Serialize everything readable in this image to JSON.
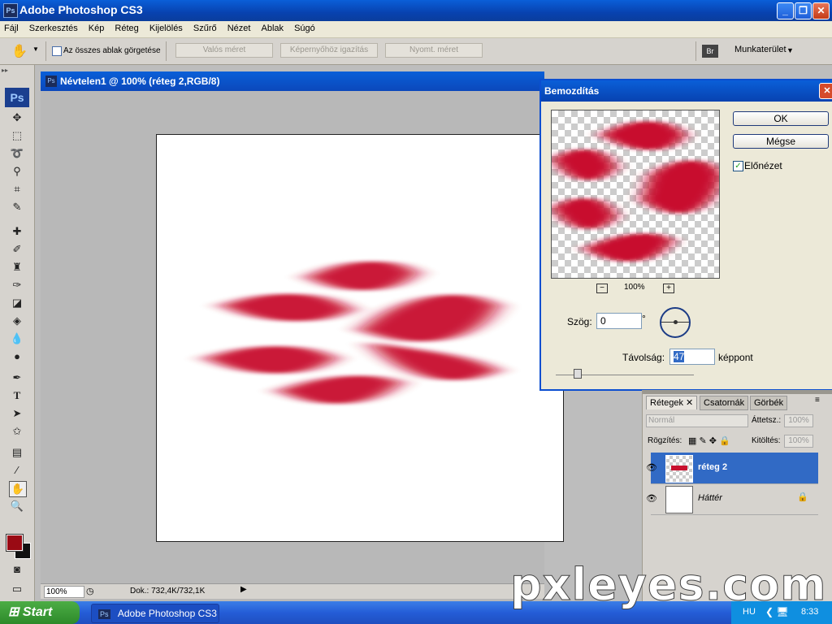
{
  "app": {
    "title": "Adobe Photoshop CS3",
    "ps_badge": "Ps"
  },
  "menu": [
    "Fájl",
    "Szerkesztés",
    "Kép",
    "Réteg",
    "Kijelölés",
    "Szűrő",
    "Nézet",
    "Ablak",
    "Súgó"
  ],
  "options": {
    "scroll_all": "Az összes ablak görgetése",
    "actual": "Valós méret",
    "fit": "Képernyőhöz igazítás",
    "print": "Nyomt. méret",
    "workspace": "Munkaterület"
  },
  "toolbox": {
    "ps": "Ps",
    "tools": [
      "move-icon",
      "marquee-icon",
      "lasso-icon",
      "magic-wand-icon",
      "crop-icon",
      "eyedropper-icon",
      "healing-icon",
      "brush-icon",
      "stamp-icon",
      "history-brush-icon",
      "eraser-icon",
      "bucket-icon",
      "blur-icon",
      "dodge-icon",
      "pen-icon",
      "type-icon",
      "path-select-icon",
      "shape-icon",
      "notes-icon",
      "eyedropper2-icon",
      "hand-icon",
      "zoom-icon"
    ],
    "fg": "#9a0a14",
    "bg": "#111111"
  },
  "document": {
    "title": "Névtelen1 @ 100% (réteg 2,RGB/8)",
    "zoom": "100%",
    "doc_info": "Dok.: 732,4K/732,1K"
  },
  "dialog": {
    "title": "Bemozdítás",
    "ok": "OK",
    "cancel": "Mégse",
    "preview_label": "Előnézet",
    "preview_checked": true,
    "zoom": "100%",
    "angle_label": "Szög:",
    "angle_value": "0",
    "angle_unit": "°",
    "distance_label": "Távolság:",
    "distance_value": "47",
    "distance_unit": "képpont",
    "distance_slider_fraction": 0.13
  },
  "layers_panel": {
    "tabs": [
      "Rétegek",
      "Csatornák",
      "Görbék"
    ],
    "blend": "Normál",
    "opacity_label": "Áttetsz.:",
    "opacity": "100%",
    "lock_label": "Rögzítés:",
    "fill_label": "Kitöltés:",
    "fill": "100%",
    "layers": [
      {
        "name": "réteg 2",
        "selected": true
      },
      {
        "name": "Háttér",
        "selected": false
      }
    ]
  },
  "taskbar": {
    "start": "Start",
    "task": "Adobe Photoshop CS3",
    "lang": "HU",
    "time": "8:33"
  },
  "watermark": "pxleyes.com"
}
